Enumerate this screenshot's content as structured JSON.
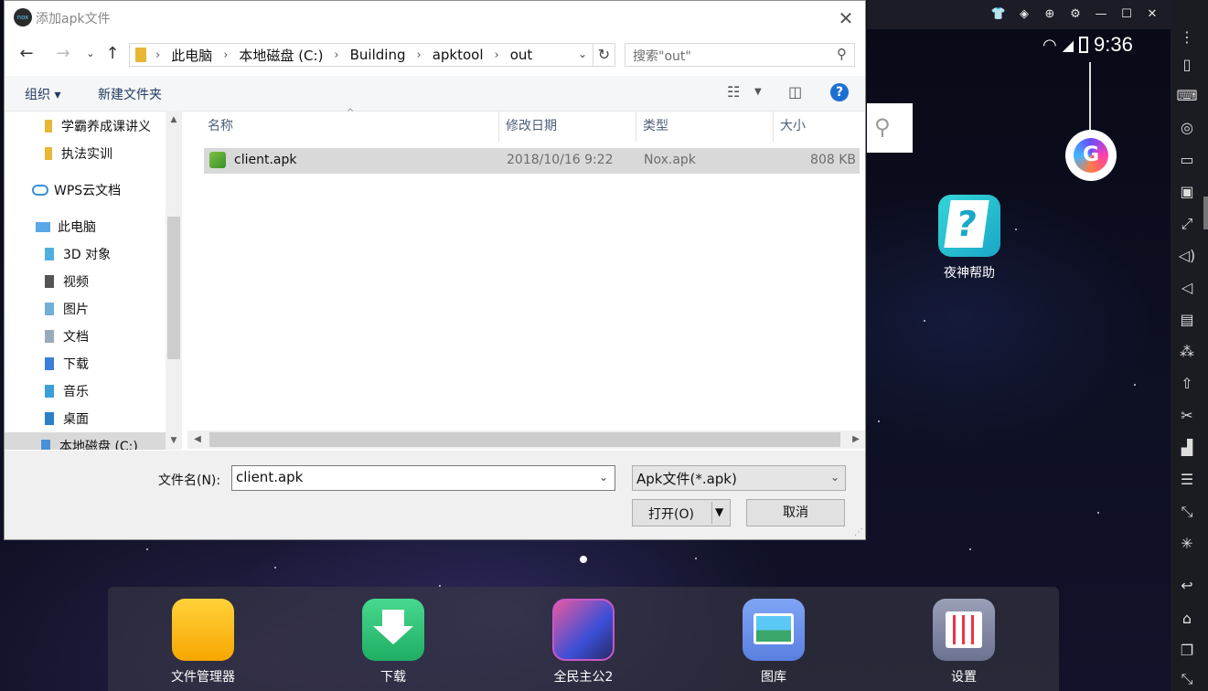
{
  "dialog": {
    "title": "添加apk文件",
    "logo": "nox-logo",
    "close": "✕",
    "address": [
      "此电脑",
      "本地磁盘 (C:)",
      "Building",
      "apktool",
      "out"
    ],
    "search_placeholder": "搜索\"out\"",
    "toolbar": {
      "organize": "组织 ▾",
      "new_folder": "新建文件夹",
      "help": "?"
    },
    "nav_items": [
      {
        "label": "学霸养成课讲义",
        "icon": "folder-icon",
        "indent": 1
      },
      {
        "label": "执法实训",
        "icon": "folder-icon",
        "indent": 1
      },
      {
        "label": "WPS云文档",
        "icon": "cloud-icon",
        "indent": 0
      },
      {
        "label": "此电脑",
        "icon": "computer-icon",
        "indent": 0
      },
      {
        "label": "3D 对象",
        "icon": "3d-objects-icon",
        "indent": 1
      },
      {
        "label": "视频",
        "icon": "video-icon",
        "indent": 1
      },
      {
        "label": "图片",
        "icon": "pictures-icon",
        "indent": 1
      },
      {
        "label": "文档",
        "icon": "documents-icon",
        "indent": 1
      },
      {
        "label": "下载",
        "icon": "downloads-icon",
        "indent": 1
      },
      {
        "label": "音乐",
        "icon": "music-icon",
        "indent": 1
      },
      {
        "label": "桌面",
        "icon": "desktop-icon",
        "indent": 1
      },
      {
        "label": "本地磁盘 (C:)",
        "icon": "drive-icon",
        "indent": 1
      }
    ],
    "columns": [
      "名称",
      "修改日期",
      "类型",
      "大小"
    ],
    "files": [
      {
        "name": "client.apk",
        "date": "2018/10/16 9:22",
        "type": "Nox.apk",
        "size": "808 KB"
      }
    ],
    "filename_label": "文件名(N):",
    "filename_value": "client.apk",
    "filetype_value": "Apk文件(*.apk)",
    "open_label": "打开(O)",
    "cancel_label": "取消"
  },
  "android": {
    "time": "9:36",
    "help_app_label": "夜神帮助",
    "dock": [
      {
        "label": "文件管理器",
        "icon": "file-manager-icon",
        "color": "#f7b500"
      },
      {
        "label": "下载",
        "icon": "download-app-icon",
        "color": "#2fc176"
      },
      {
        "label": "全民主公2",
        "icon": "game-icon",
        "color": "#5a6fd8"
      },
      {
        "label": "图库",
        "icon": "gallery-icon",
        "color": "#6c8fe8"
      },
      {
        "label": "设置",
        "icon": "settings-icon",
        "color": "#8a90a8"
      }
    ]
  },
  "emulator": {
    "top_icons": [
      "shirt-icon",
      "menu-icon",
      "pin-icon",
      "gear-icon",
      "minimize-icon",
      "maximize-icon",
      "close-icon"
    ],
    "sidebar_icons": [
      "more-icon",
      "shake-icon",
      "keyboard-icon",
      "location-icon",
      "multi-instance-icon",
      "screenshot-icon",
      "fullscreen-icon",
      "volume-up-icon",
      "volume-down-icon",
      "toolbox-icon",
      "macro-icon",
      "apk-install-icon",
      "scissors-icon",
      "sync-icon",
      "menu-lines-icon",
      "resize-icon",
      "loading-icon",
      "back-icon",
      "home-icon",
      "recent-apps-icon",
      "expand-icon"
    ]
  }
}
